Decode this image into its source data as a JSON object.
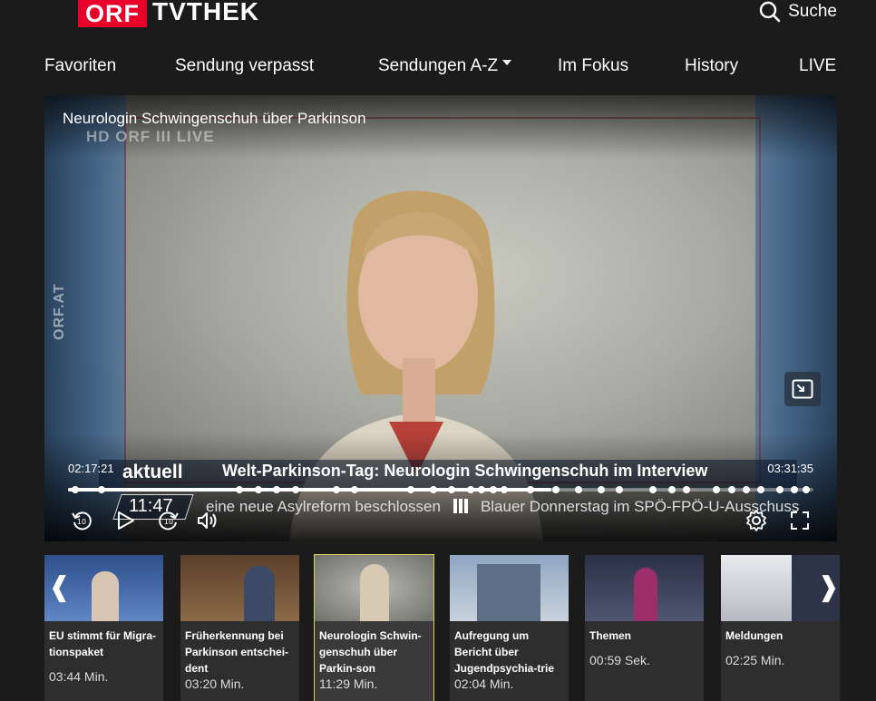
{
  "header": {
    "logo_orf": "ORF",
    "logo_tvthek": "TVTHEK",
    "search_label": "Suche"
  },
  "nav": {
    "items": [
      "Favoriten",
      "Sendung verpasst",
      "Sendungen A-Z",
      "Im Fokus",
      "History",
      "LIVE"
    ]
  },
  "player": {
    "title": "Neurologin Schwingenschuh über Parkinson",
    "channel_bug": "HD ORF III LIVE",
    "side_text": "ORF.AT",
    "time_elapsed": "02:17:21",
    "time_total": "03:31:35",
    "progress_fraction": 0.648,
    "lower_third_logo": "aktuell",
    "lower_third_headline": "Welt-Parkinson-Tag: Neurologin Schwingenschuh im Interview",
    "clock": "11:47",
    "ticker_left": "eine neue Asylreform beschlossen",
    "ticker_right": "Blauer Donnerstag im SPÖ-FPÖ-U-Ausschuss",
    "controls": {
      "rewind": "rewind-10-icon",
      "play": "play-icon",
      "forward": "forward-10-icon",
      "volume": "volume-icon",
      "settings": "gear-icon",
      "fullscreen": "fullscreen-icon",
      "pip": "picture-in-picture-icon"
    }
  },
  "carousel": {
    "items": [
      {
        "title": "EU stimmt für Migra-tionspaket",
        "duration": "03:44 Min.",
        "thumb": "#4a6fb0"
      },
      {
        "title": "Früherkennung bei Parkinson entschei-dent",
        "duration": "03:20 Min.",
        "thumb": "#7a5a3a"
      },
      {
        "title": "Neurologin Schwin-genschuh über Parkin-son",
        "duration": "11:29 Min.",
        "thumb": "#8a8c84"
      },
      {
        "title": "Aufregung um Bericht über Jugendpsychia-trie",
        "duration": "02:04 Min.",
        "thumb": "#6f8196"
      },
      {
        "title": "Themen",
        "duration": "00:59 Sek.",
        "thumb": "#3a3f55"
      },
      {
        "title": "Meldungen",
        "duration": "02:25 Min.",
        "thumb": "#c9ccd2"
      }
    ],
    "prev_icon": "chevron-left-icon",
    "next_icon": "chevron-right-icon"
  },
  "colors": {
    "brand_red": "#e8002a",
    "background": "#1b1b1b",
    "active_outline": "#d9d05a"
  }
}
